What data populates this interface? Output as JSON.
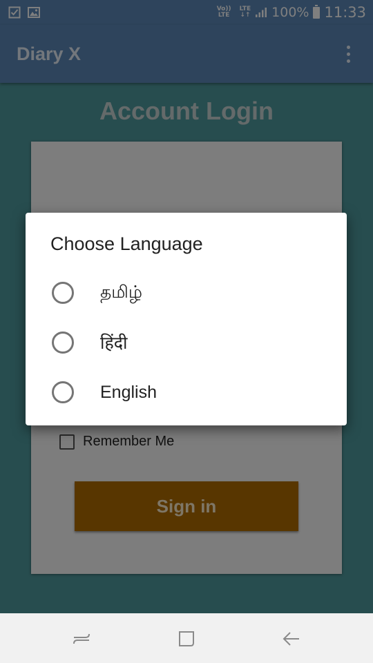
{
  "status_bar": {
    "network_top": "Vo))",
    "network_bottom": "LTE",
    "lte_label": "LTE",
    "battery_percent": "100%",
    "battery_level": 1.0,
    "time": "11:33",
    "icons": [
      "checkbox-notification-icon",
      "image-notification-icon",
      "signal-icon",
      "battery-icon"
    ]
  },
  "app_bar": {
    "title": "Diary X",
    "overflow_icon": "more-vertical-icon"
  },
  "login": {
    "title": "Account Login",
    "remember_label": "Remember Me",
    "signin_label": "Sign in"
  },
  "dialog": {
    "title": "Choose Language",
    "options": [
      {
        "label": "தமிழ்",
        "selected": false
      },
      {
        "label": "हिंदी",
        "selected": false
      },
      {
        "label": "English",
        "selected": false
      }
    ]
  },
  "nav_bar": {
    "icons": [
      "recent-apps-icon",
      "home-icon",
      "back-icon"
    ]
  },
  "colors": {
    "app_bar": "#5c89b8",
    "background": "#4f9a9e",
    "signin_button": "#b06d00"
  }
}
